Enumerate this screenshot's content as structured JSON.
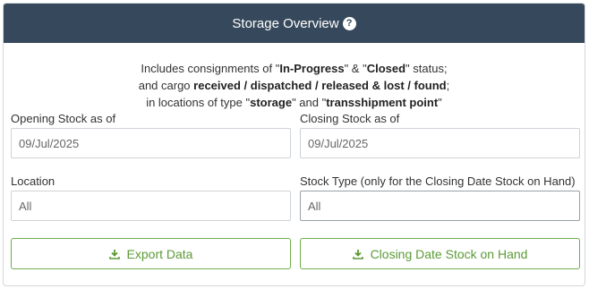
{
  "header": {
    "title": "Storage Overview",
    "help_icon_text": "?"
  },
  "info": {
    "line1": {
      "pre": "Includes consignments of \"",
      "b1": "In-Progress",
      "mid": "\" & \"",
      "b2": "Closed",
      "post": "\" status;"
    },
    "line2": {
      "pre": "and cargo ",
      "b1": "received / dispatched / released & lost / found",
      "post": ";"
    },
    "line3": {
      "pre": "in locations of type \"",
      "b1": "storage",
      "mid": "\" and \"",
      "b2": "transshipment point",
      "post": "\""
    }
  },
  "form": {
    "opening_label": "Opening Stock as of",
    "opening_value": "09/Jul/2025",
    "closing_label": "Closing Stock as of",
    "closing_value": "09/Jul/2025",
    "location_label": "Location",
    "location_value": "All",
    "stock_type_label": "Stock Type (only for the Closing Date Stock on Hand)",
    "stock_type_value": "All"
  },
  "buttons": {
    "export": "Export Data",
    "closing_stock": "Closing Date Stock on Hand"
  },
  "colors": {
    "header_bg": "#36495c",
    "accent_green": "#5b9b37"
  }
}
